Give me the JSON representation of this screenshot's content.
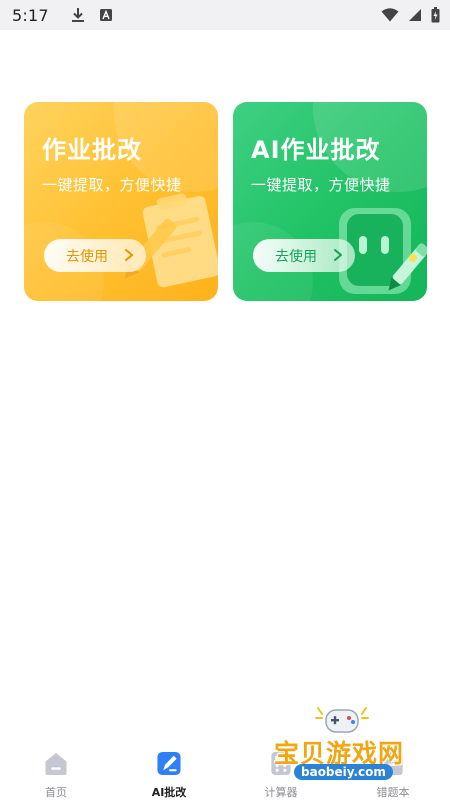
{
  "status_bar": {
    "time": "5:17",
    "left_icons": [
      "download-icon",
      "a-box-icon"
    ],
    "right_icons": [
      "wifi-icon",
      "signal-icon",
      "battery-icon"
    ]
  },
  "cards": [
    {
      "title": "作业批改",
      "subtitle": "一键提取，方便快捷",
      "button": "去使用",
      "color": "#ffbf2e",
      "illustration": "notepad-pencil-icon"
    },
    {
      "title": "AI作业批改",
      "subtitle": "一键提取，方便快捷",
      "button": "去使用",
      "color": "#1fc264",
      "illustration": "robot-pen-icon"
    }
  ],
  "bottom_nav": {
    "items": [
      {
        "label": "首页",
        "icon": "home-icon"
      },
      {
        "label": "AI批改",
        "icon": "pen-edit-icon",
        "active": true
      },
      {
        "label": "计算器",
        "icon": "calculator-icon"
      },
      {
        "label": "错题本",
        "icon": "notebook-icon"
      }
    ],
    "active_color": "#2f7ff6",
    "inactive_color": "#c5c8d2"
  },
  "watermark": {
    "name": "宝贝游戏网",
    "url": "baobeiy.com"
  }
}
